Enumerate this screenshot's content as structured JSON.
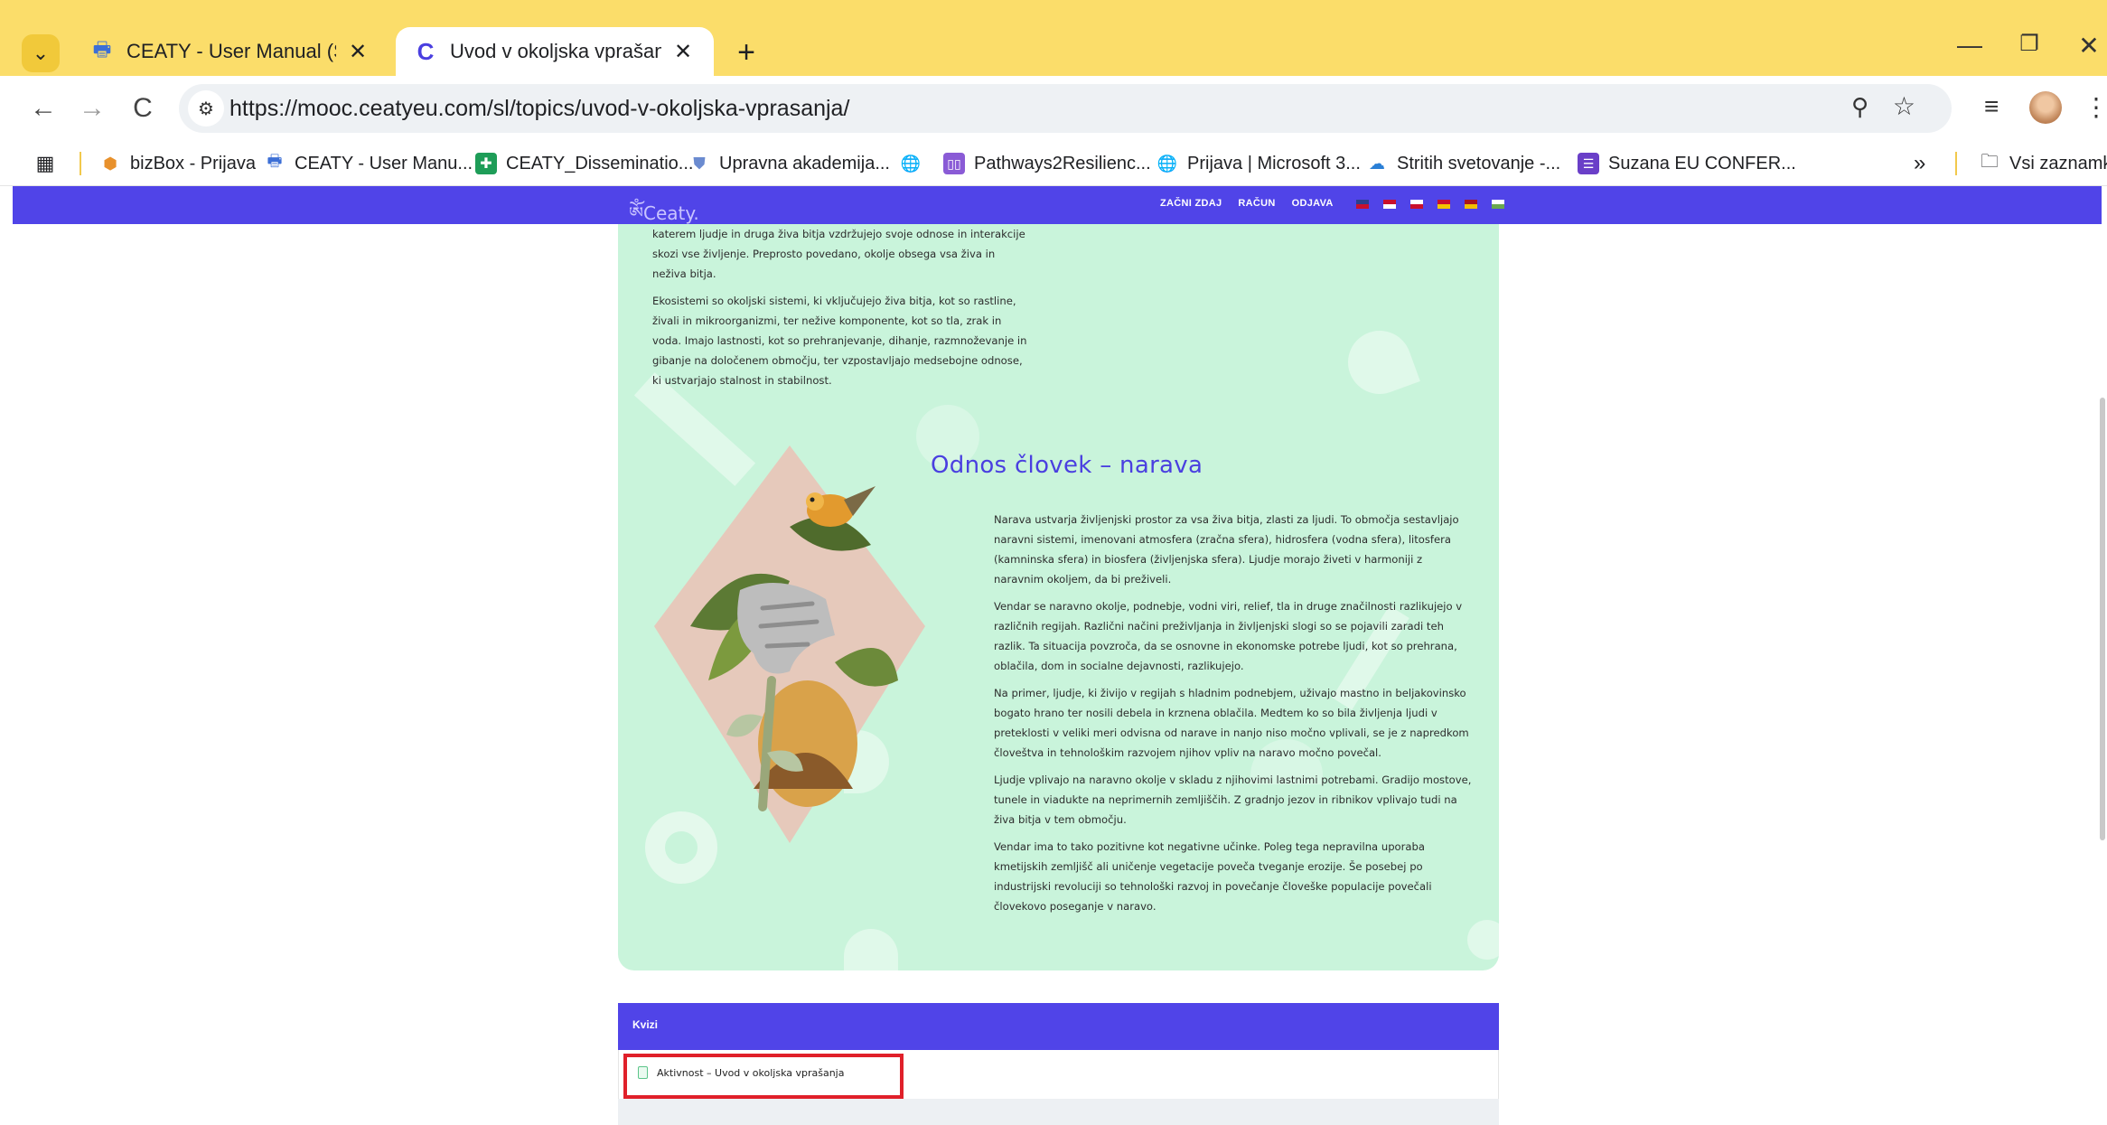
{
  "browser": {
    "tabs": [
      {
        "title": "CEATY - User Manual (Slovenia)",
        "icon": "printer-icon",
        "active": false
      },
      {
        "title": "Uvod v okoljska vprašanja | Mooc",
        "icon": "ceaty-c-icon",
        "active": true
      }
    ],
    "url": "https://mooc.ceatyeu.com/sl/topics/uvod-v-okoljska-vprasanja/",
    "bookmarks": [
      {
        "label": "bizBox - Prijava",
        "icon": "cube-icon",
        "color": "#e8912c"
      },
      {
        "label": "CEATY - User Manu...",
        "icon": "printer-icon",
        "color": "#3c6fd6"
      },
      {
        "label": "CEATY_Disseminatio...",
        "icon": "sheets-icon",
        "color": "#1e9d58"
      },
      {
        "label": "Upravna akademija...",
        "icon": "shield-icon",
        "color": "#6b8bd0"
      },
      {
        "label": "",
        "icon": "globe-icon",
        "color": "#333333"
      },
      {
        "label": "Pathways2Resilienc...",
        "icon": "book-icon",
        "color": "#8a5bd6"
      },
      {
        "label": "Prijava | Microsoft 3...",
        "icon": "globe-icon",
        "color": "#333333"
      },
      {
        "label": "Stritih svetovanje -...",
        "icon": "cloud-icon",
        "color": "#2a7fd6"
      },
      {
        "label": "Suzana EU CONFER...",
        "icon": "forms-icon",
        "color": "#6a3fc8"
      }
    ],
    "bookmarks_more": "»",
    "all_bookmarks": "Vsi zaznamki"
  },
  "site": {
    "logo": "Ceaty.",
    "nav": [
      "ZAČNI ZDAJ",
      "RAČUN",
      "ODJAVA"
    ],
    "flag_colors": [
      [
        "#2a3f8f",
        "#c8102e"
      ],
      [
        "#c8102e",
        "#ffffff"
      ],
      [
        "#ffffff",
        "#c8102e"
      ],
      [
        "#c8102e",
        "#f4c400"
      ],
      [
        "#aa151b",
        "#f1bf00"
      ],
      [
        "#ffffff",
        "#6aa84f"
      ]
    ],
    "intro": [
      "katerem ljudje in druga živa bitja vzdržujejo svoje odnose in interakcije skozi vse življenje. Preprosto povedano, okolje obsega vsa živa in neživa bitja.",
      "Ekosistemi so okoljski sistemi, ki vključujejo živa bitja, kot so rastline, živali in mikroorganizmi, ter nežive komponente, kot so tla, zrak in voda. Imajo lastnosti, kot so prehranjevanje, dihanje, razmnoževanje in gibanje na določenem območju, ter vzpostavljajo medsebojne odnose, ki ustvarjajo stalnost in stabilnost."
    ],
    "section_title": "Odnos človek – narava",
    "paragraphs": [
      "Narava ustvarja življenjski prostor za vsa živa bitja, zlasti za ljudi. To območja sestavljajo naravni sistemi, imenovani atmosfera (zračna sfera), hidrosfera (vodna sfera), litosfera (kamninska sfera) in biosfera (življenjska sfera). Ljudje morajo živeti v harmoniji z naravnim okoljem, da bi preživeli.",
      "Vendar se naravno okolje, podnebje, vodni viri, relief, tla in druge značilnosti razlikujejo v različnih regijah. Različni načini preživljanja in življenjski slogi so se pojavili zaradi teh razlik. Ta situacija povzroča, da se osnovne in ekonomske potrebe ljudi, kot so prehrana, oblačila, dom in socialne dejavnosti, razlikujejo.",
      "Na primer, ljudje, ki živijo v regijah s hladnim podnebjem, uživajo mastno in beljakovinsko bogato hrano ter nosili debela in krznena oblačila. Medtem ko so bila življenja ljudi v preteklosti v veliki meri odvisna od narave in nanjo niso močno vplivali, se je z napredkom človeštva in tehnološkim razvojem njihov vpliv na naravo močno povečal.",
      "Ljudje vplivajo na naravno okolje v skladu z njihovimi lastnimi potrebami. Gradijo mostove, tunele in viadukte na neprimernih zemljiščih. Z gradnjo jezov in ribnikov vplivajo tudi na živa bitja v tem območju.",
      "Vendar ima to tako pozitivne kot negativne učinke. Poleg tega nepravilna uporaba kmetijskih zemljišč ali uničenje vegetacije poveča tveganje erozije. Še posebej po industrijski revoluciji so tehnološki razvoj in povečanje človeške populacije povečali človekovo poseganje v naravo."
    ],
    "quiz": {
      "header": "Kvizi",
      "item": "Aktivnost – Uvod v okoljska vprašanja"
    }
  }
}
